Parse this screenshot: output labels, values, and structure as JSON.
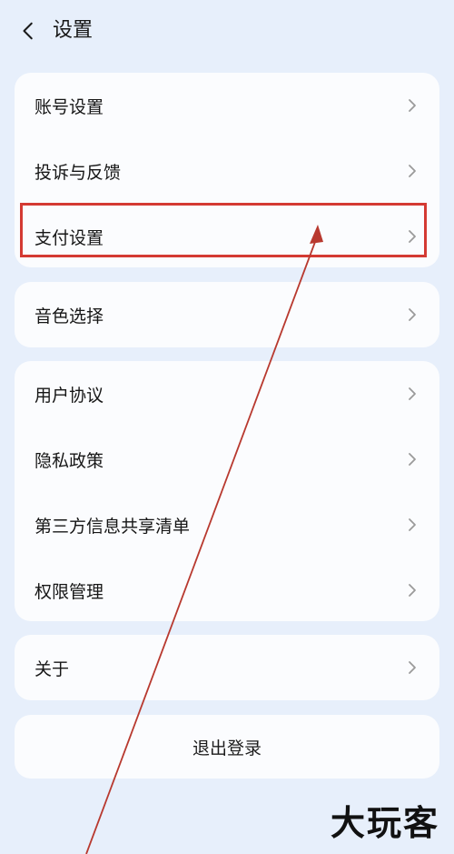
{
  "header": {
    "title": "设置",
    "back_icon": "chevron-left-icon"
  },
  "groups": [
    {
      "items": [
        {
          "label": "账号设置"
        },
        {
          "label": "投诉与反馈"
        },
        {
          "label": "支付设置"
        }
      ]
    },
    {
      "items": [
        {
          "label": "音色选择"
        }
      ]
    },
    {
      "items": [
        {
          "label": "用户协议"
        },
        {
          "label": "隐私政策"
        },
        {
          "label": "第三方信息共享清单"
        },
        {
          "label": "权限管理"
        }
      ]
    },
    {
      "items": [
        {
          "label": "关于"
        }
      ]
    }
  ],
  "logout": {
    "label": "退出登录"
  },
  "watermark": {
    "text": "大玩客"
  },
  "colors": {
    "background": "#e7effb",
    "card": "#fbfcfe",
    "highlight": "#d43a33",
    "chevron": "#9a9a9a"
  }
}
